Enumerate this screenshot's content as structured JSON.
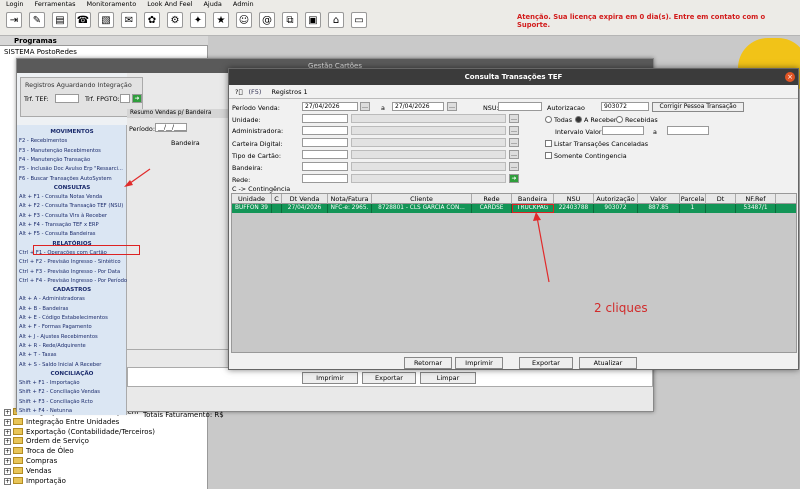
{
  "menubar": [
    "Login",
    "Ferramentas",
    "Monitoramento",
    "Look And Feel",
    "Ajuda",
    "Admin"
  ],
  "alert": "Atenção. Sua licença expira em 0 dia(s). Entre em contato com o Suporte.",
  "tree": {
    "title": "Programas",
    "root": "SISTEMA PostoRedes",
    "items": [
      "Integração Mento x AutoSystem",
      "Integração Entre Unidades",
      "Exportação (Contabilidade/Terceiros)",
      "Ordem de Serviço",
      "Troca de Óleo",
      "Compras",
      "Vendas",
      "Importação"
    ]
  },
  "bgwin": {
    "title": "Gestão Cartões",
    "reg_title": "Registros Aguardando Integração",
    "trf_tef": "Trf. TEF:",
    "trf_fpgto": "Trf. FPGTO:",
    "menu": [
      {
        "h": "MOVIMENTOS"
      },
      {
        "i": "F2 - Recebimentos"
      },
      {
        "i": "F3 - Manutenção Recebimentos"
      },
      {
        "i": "F4 - Manutenção Transação"
      },
      {
        "i": "F5 - Inclusão Doc Avulso Erp \"Ressarci..."
      },
      {
        "i": "F6 - Buscar Transações AutoSystem"
      },
      {
        "h": "CONSULTAS"
      },
      {
        "i": "Alt + F1 - Consulta Notas Venda"
      },
      {
        "i": "Alt + F2 - Consulta Transação TEF (NSU)"
      },
      {
        "i": "Alt + F3 - Consulta Vlrs à Receber"
      },
      {
        "i": "Alt + F4 - Transação TEF x ERP"
      },
      {
        "i": "Alt + F5 - Consulta Bandeiras"
      },
      {
        "h": "RELATÓRIOS"
      },
      {
        "i": "Ctrl + F1 - Operações com Cartão"
      },
      {
        "i": "Ctrl + F2 - Previsão Ingresso - Sintético"
      },
      {
        "i": "Ctrl + F3 - Previsão Ingresso - Por Data"
      },
      {
        "i": "Ctrl + F4 - Previsão Ingresso - Por Período"
      },
      {
        "h": "CADASTROS"
      },
      {
        "i": "Alt + A - Administradoras"
      },
      {
        "i": "Alt + B - Bandeiras"
      },
      {
        "i": "Alt + E - Código Estabelecimentos"
      },
      {
        "i": "Alt + F - Formas Pagamento"
      },
      {
        "i": "Alt + J - Ajustes Recebimentos"
      },
      {
        "i": "Alt + R - Rede/Adquirente"
      },
      {
        "i": "Alt + T - Taxas"
      },
      {
        "i": "Alt + S - Saldo Inicial A Receber"
      },
      {
        "h": "CONCILIAÇÃO"
      },
      {
        "i": "Shift + F1 - Importação"
      },
      {
        "i": "Shift + F2 - Conciliação Vendas"
      },
      {
        "i": "Shift + F3 - Conciliação Rcto"
      },
      {
        "i": "Shift + F4 - Netunna"
      }
    ],
    "tab": "Resumo Vendas p/ Bandeira",
    "periodo": "Período:",
    "periodo_val": "__/__/____",
    "col_bandeira": "Bandeira",
    "totais": "Totais Faturamento: R$",
    "btn_imprimir": "Imprimir",
    "btn_exportar": "Exportar",
    "btn_limpar": "Limpar"
  },
  "dlg": {
    "title": "Consulta Transações TEF",
    "f5": "(F5)",
    "registros": "Registros 1",
    "labels": {
      "periodo": "Período Venda:",
      "a": "a",
      "nsu": "NSU:",
      "autorizacao": "Autorizacao",
      "unidade": "Unidade:",
      "administradora": "Administradora:",
      "carteira": "Carteira Digital:",
      "tipo": "Tipo de Cartão:",
      "bandeira": "Bandeira:",
      "rede": "Rede:",
      "intervalo": "Intervalo Valor:",
      "a2": "a",
      "contingencia": "C -> Contingência"
    },
    "values": {
      "dt_ini": "27/04/2026",
      "dt_fim": "27/04/2026",
      "autorizacao": "903072"
    },
    "corrigir": "Corrigir Pessoa Transação",
    "radios": [
      "Todas",
      "A Receber",
      "Recebidas"
    ],
    "checks": [
      "Listar Transações Canceladas",
      "Somente Contingencia"
    ],
    "columns": [
      "Unidade",
      "C",
      "Dt Venda",
      "Nota/Fatura",
      "Cliente",
      "Rede",
      "Bandeira",
      "NSU",
      "Autorização",
      "Valor",
      "Parcela",
      "Dt Cancel",
      "NF.Ref"
    ],
    "row": [
      "BUFFON 39",
      "",
      "27/04/2026",
      "NFC-e: 2965.",
      "8728801 - CLS GARCIA CON...",
      "CARDSE",
      "TRUCKPAG",
      "22403788",
      "903072",
      "887.85",
      "1",
      "",
      "53487/1"
    ],
    "btns": [
      "Retornar",
      "Imprimir",
      "Exportar",
      "Atualizar"
    ],
    "note": "2 cliques"
  }
}
